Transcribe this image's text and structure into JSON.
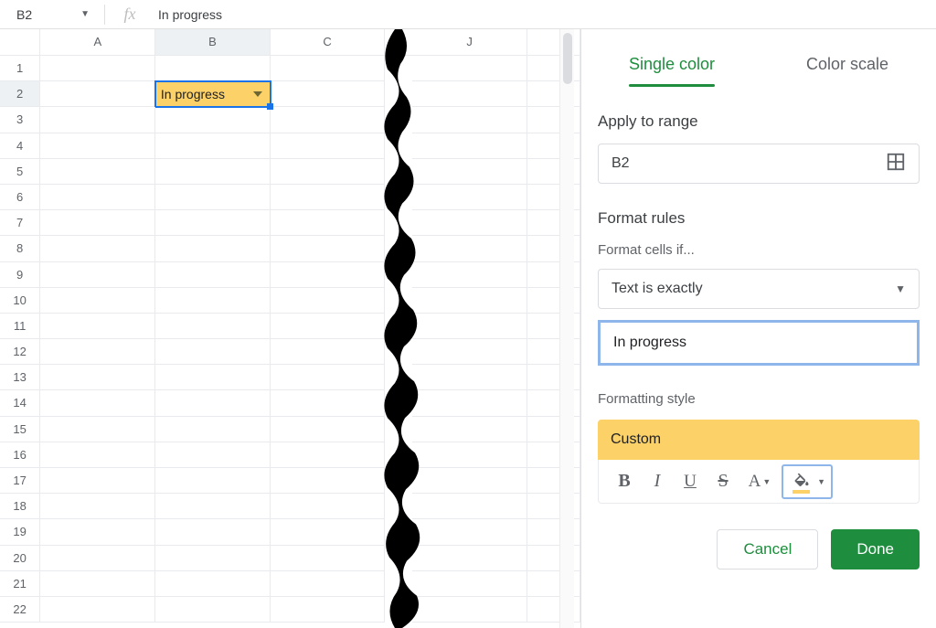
{
  "formula_bar": {
    "cell_ref": "B2",
    "value": "In progress"
  },
  "columns": {
    "A": "A",
    "B": "B",
    "C": "C",
    "J": "J"
  },
  "row_count": 22,
  "active_cell": {
    "value": "In progress"
  },
  "sidebar": {
    "tabs": {
      "single": "Single color",
      "scale": "Color scale"
    },
    "apply_label": "Apply to range",
    "range_value": "B2",
    "rules_label": "Format rules",
    "cells_if_label": "Format cells if...",
    "condition": "Text is exactly",
    "condition_value": "In progress",
    "style_label": "Formatting style",
    "style_name": "Custom",
    "toolbar": {
      "bold": "B",
      "italic": "I",
      "underline": "U",
      "strike": "S",
      "textcolor": "A"
    },
    "buttons": {
      "cancel": "Cancel",
      "done": "Done"
    }
  }
}
